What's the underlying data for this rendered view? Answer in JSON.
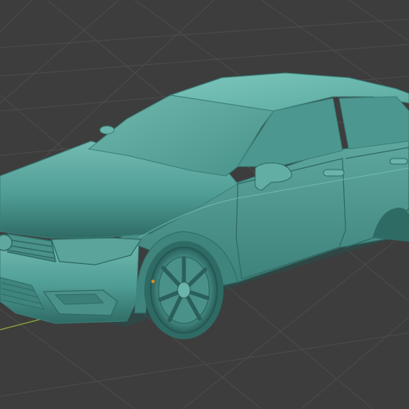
{
  "viewport": {
    "kind": "3d-viewport",
    "background_color": "#3d3d3d",
    "grid_color": "#4c4c4c",
    "axis_color": "#8aa83a",
    "object": {
      "name_icon": "car-model",
      "shading": "solid",
      "body_color": "#4f9e96",
      "body_shadow_color": "#2f6b65",
      "body_highlight_color": "#7cc7bd",
      "origin_dot_color": "#d78a25"
    }
  }
}
